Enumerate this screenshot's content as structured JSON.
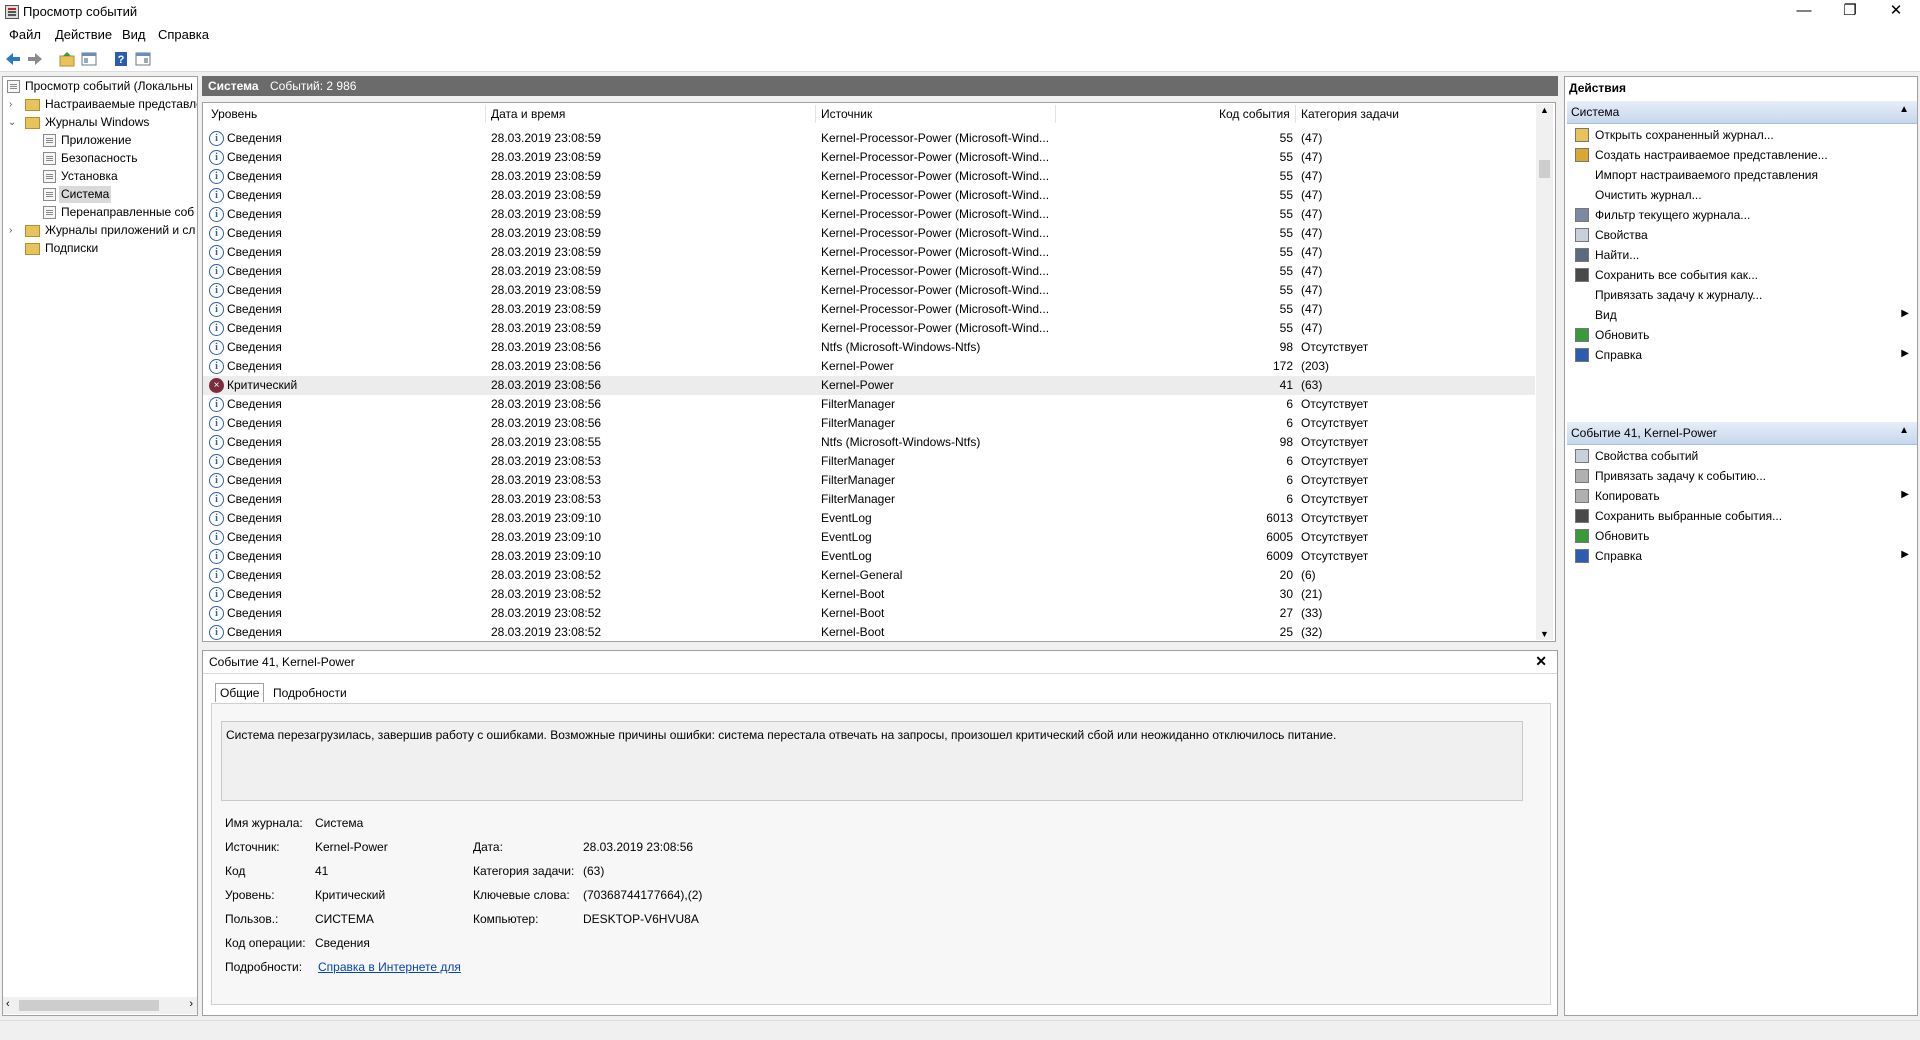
{
  "window": {
    "title": "Просмотр событий",
    "minimize": "—",
    "maximize": "❐",
    "close": "✕"
  },
  "menu": [
    "Файл",
    "Действие",
    "Вид",
    "Справка"
  ],
  "tree": {
    "root": "Просмотр событий (Локальны",
    "custom_views": "Настраиваемые представле",
    "windows_logs": "Журналы Windows",
    "application": "Приложение",
    "security": "Безопасность",
    "setup": "Установка",
    "system": "Система",
    "forwarded": "Перенаправленные соб",
    "app_logs": "Журналы приложений и сл",
    "subscriptions": "Подписки"
  },
  "log_header": {
    "name": "Система",
    "count": "Событий: 2 986"
  },
  "columns": [
    "Уровень",
    "Дата и время",
    "Источник",
    "Код события",
    "Категория задачи"
  ],
  "events": [
    {
      "level": "Сведения",
      "date": "28.03.2019 23:08:59",
      "source": "Kernel-Processor-Power (Microsoft-Wind...",
      "code": "55",
      "category": "(47)"
    },
    {
      "level": "Сведения",
      "date": "28.03.2019 23:08:59",
      "source": "Kernel-Processor-Power (Microsoft-Wind...",
      "code": "55",
      "category": "(47)"
    },
    {
      "level": "Сведения",
      "date": "28.03.2019 23:08:59",
      "source": "Kernel-Processor-Power (Microsoft-Wind...",
      "code": "55",
      "category": "(47)"
    },
    {
      "level": "Сведения",
      "date": "28.03.2019 23:08:59",
      "source": "Kernel-Processor-Power (Microsoft-Wind...",
      "code": "55",
      "category": "(47)"
    },
    {
      "level": "Сведения",
      "date": "28.03.2019 23:08:59",
      "source": "Kernel-Processor-Power (Microsoft-Wind...",
      "code": "55",
      "category": "(47)"
    },
    {
      "level": "Сведения",
      "date": "28.03.2019 23:08:59",
      "source": "Kernel-Processor-Power (Microsoft-Wind...",
      "code": "55",
      "category": "(47)"
    },
    {
      "level": "Сведения",
      "date": "28.03.2019 23:08:59",
      "source": "Kernel-Processor-Power (Microsoft-Wind...",
      "code": "55",
      "category": "(47)"
    },
    {
      "level": "Сведения",
      "date": "28.03.2019 23:08:59",
      "source": "Kernel-Processor-Power (Microsoft-Wind...",
      "code": "55",
      "category": "(47)"
    },
    {
      "level": "Сведения",
      "date": "28.03.2019 23:08:59",
      "source": "Kernel-Processor-Power (Microsoft-Wind...",
      "code": "55",
      "category": "(47)"
    },
    {
      "level": "Сведения",
      "date": "28.03.2019 23:08:59",
      "source": "Kernel-Processor-Power (Microsoft-Wind...",
      "code": "55",
      "category": "(47)"
    },
    {
      "level": "Сведения",
      "date": "28.03.2019 23:08:59",
      "source": "Kernel-Processor-Power (Microsoft-Wind...",
      "code": "55",
      "category": "(47)"
    },
    {
      "level": "Сведения",
      "date": "28.03.2019 23:08:56",
      "source": "Ntfs (Microsoft-Windows-Ntfs)",
      "code": "98",
      "category": "Отсутствует"
    },
    {
      "level": "Сведения",
      "date": "28.03.2019 23:08:56",
      "source": "Kernel-Power",
      "code": "172",
      "category": "(203)"
    },
    {
      "level": "Критический",
      "date": "28.03.2019 23:08:56",
      "source": "Kernel-Power",
      "code": "41",
      "category": "(63)",
      "critical": true
    },
    {
      "level": "Сведения",
      "date": "28.03.2019 23:08:56",
      "source": "FilterManager",
      "code": "6",
      "category": "Отсутствует"
    },
    {
      "level": "Сведения",
      "date": "28.03.2019 23:08:56",
      "source": "FilterManager",
      "code": "6",
      "category": "Отсутствует"
    },
    {
      "level": "Сведения",
      "date": "28.03.2019 23:08:55",
      "source": "Ntfs (Microsoft-Windows-Ntfs)",
      "code": "98",
      "category": "Отсутствует"
    },
    {
      "level": "Сведения",
      "date": "28.03.2019 23:08:53",
      "source": "FilterManager",
      "code": "6",
      "category": "Отсутствует"
    },
    {
      "level": "Сведения",
      "date": "28.03.2019 23:08:53",
      "source": "FilterManager",
      "code": "6",
      "category": "Отсутствует"
    },
    {
      "level": "Сведения",
      "date": "28.03.2019 23:08:53",
      "source": "FilterManager",
      "code": "6",
      "category": "Отсутствует"
    },
    {
      "level": "Сведения",
      "date": "28.03.2019 23:09:10",
      "source": "EventLog",
      "code": "6013",
      "category": "Отсутствует"
    },
    {
      "level": "Сведения",
      "date": "28.03.2019 23:09:10",
      "source": "EventLog",
      "code": "6005",
      "category": "Отсутствует"
    },
    {
      "level": "Сведения",
      "date": "28.03.2019 23:09:10",
      "source": "EventLog",
      "code": "6009",
      "category": "Отсутствует"
    },
    {
      "level": "Сведения",
      "date": "28.03.2019 23:08:52",
      "source": "Kernel-General",
      "code": "20",
      "category": "(6)"
    },
    {
      "level": "Сведения",
      "date": "28.03.2019 23:08:52",
      "source": "Kernel-Boot",
      "code": "30",
      "category": "(21)"
    },
    {
      "level": "Сведения",
      "date": "28.03.2019 23:08:52",
      "source": "Kernel-Boot",
      "code": "27",
      "category": "(33)"
    },
    {
      "level": "Сведения",
      "date": "28.03.2019 23:08:52",
      "source": "Kernel-Boot",
      "code": "25",
      "category": "(32)"
    }
  ],
  "detail": {
    "title": "Событие 41, Kernel-Power",
    "tabs": [
      "Общие",
      "Подробности"
    ],
    "description": "Система перезагрузилась, завершив работу с ошибками. Возможные причины ошибки: система перестала отвечать на запросы, произошел критический сбой или неожиданно отключилось питание.",
    "log_name_label": "Имя журнала:",
    "log_name": "Система",
    "source_label": "Источник:",
    "source": "Kernel-Power",
    "date_label": "Дата:",
    "date": "28.03.2019 23:08:56",
    "code_label": "Код",
    "code": "41",
    "task_label": "Категория задачи:",
    "task": "(63)",
    "level_label": "Уровень:",
    "level": "Критический",
    "keywords_label": "Ключевые слова:",
    "keywords": "(70368744177664),(2)",
    "user_label": "Пользов.:",
    "user": "СИСТЕМА",
    "computer_label": "Компьютер:",
    "computer": "DESKTOP-V6HVU8A",
    "opcode_label": "Код операции:",
    "opcode": "Сведения",
    "more_label": "Подробности:",
    "more_link": "Справка в Интернете для "
  },
  "actions": {
    "title": "Действия",
    "section1": "Система",
    "items1": [
      {
        "label": "Открыть сохраненный журнал...",
        "icon": "open-folder-icon"
      },
      {
        "label": "Создать настраиваемое представление...",
        "icon": "filter-create-icon"
      },
      {
        "label": "Импорт настраиваемого представления",
        "icon": ""
      },
      {
        "label": "Очистить журнал...",
        "icon": ""
      },
      {
        "label": "Фильтр текущего журнала...",
        "icon": "filter-icon"
      },
      {
        "label": "Свойства",
        "icon": "properties-icon"
      },
      {
        "label": "Найти...",
        "icon": "find-icon"
      },
      {
        "label": "Сохранить все события как...",
        "icon": "save-icon"
      },
      {
        "label": "Привязать задачу к журналу...",
        "icon": ""
      },
      {
        "label": "Вид",
        "icon": "",
        "submenu": true
      },
      {
        "label": "Обновить",
        "icon": "refresh-icon"
      },
      {
        "label": "Справка",
        "icon": "help-icon",
        "submenu": true
      }
    ],
    "section2": "Событие 41, Kernel-Power",
    "items2": [
      {
        "label": "Свойства событий",
        "icon": "properties-icon"
      },
      {
        "label": "Привязать задачу к событию...",
        "icon": "task-icon"
      },
      {
        "label": "Копировать",
        "icon": "copy-icon",
        "submenu": true
      },
      {
        "label": "Сохранить выбранные события...",
        "icon": "save-icon"
      },
      {
        "label": "Обновить",
        "icon": "refresh-icon"
      },
      {
        "label": "Справка",
        "icon": "help-icon",
        "submenu": true
      }
    ]
  }
}
